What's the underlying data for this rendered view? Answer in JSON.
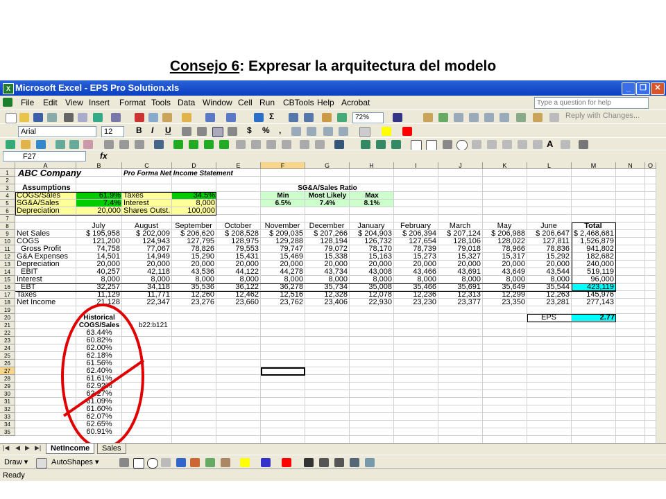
{
  "slide": {
    "title_underlined": "Consejo 6",
    "title_rest": ": Expresar la arquitectura del modelo"
  },
  "window": {
    "title": "Microsoft Excel - EPS Pro Solution.xls",
    "min": "_",
    "max": "❐",
    "close": "✕"
  },
  "menu": [
    "File",
    "Edit",
    "View",
    "Insert",
    "Format",
    "Tools",
    "Data",
    "Window",
    "Cell",
    "Run",
    "CBTools",
    "Help",
    "Acrobat"
  ],
  "help_placeholder": "Type a question for help",
  "toolbar": {
    "font": "Arial",
    "size": "12",
    "zoom": "72%",
    "reply": "Reply with Changes...",
    "bold": "B",
    "italic": "I",
    "underline": "U",
    "currency": "$",
    "percent": "%",
    "comma": ",",
    "sigma": "Σ"
  },
  "formula_bar": {
    "name_box": "F27",
    "fx": "fx"
  },
  "columns": [
    "A",
    "B",
    "C",
    "D",
    "E",
    "F",
    "G",
    "H",
    "I",
    "J",
    "K",
    "L",
    "M",
    "N",
    "O"
  ],
  "rows": [
    "1",
    "2",
    "3",
    "4",
    "5",
    "6",
    "7",
    "8",
    "9",
    "10",
    "11",
    "12",
    "13",
    "14",
    "15",
    "16",
    "17",
    "18",
    "19",
    "20",
    "21",
    "22",
    "23",
    "24",
    "25",
    "26",
    "27",
    "28",
    "29",
    "30",
    "31",
    "32",
    "33",
    "34",
    "35"
  ],
  "sheet": {
    "company": "ABC Company",
    "subtitle": "Pro Forma Net Income Statement",
    "assumptions": "Assumptions",
    "a4": "COGS/Sales",
    "b4": "61.9%",
    "c4": "Taxes",
    "d4": "34.5%",
    "a5": "SG&A/Sales",
    "b5": "7.4%",
    "c5": "Interest",
    "d5": "8,000",
    "a6": "Depreciation",
    "b6": "20,000",
    "c6": "Shares Outst.",
    "d6": "100,000",
    "sga_title": "SG&A/Sales Ratio",
    "sga_headers": [
      "Min",
      "Most Likely",
      "Max"
    ],
    "sga_values": [
      "6.5%",
      "7.4%",
      "8.1%"
    ],
    "months": [
      "July",
      "August",
      "September",
      "October",
      "November",
      "December",
      "January",
      "February",
      "March",
      "May",
      "June",
      "Total"
    ],
    "line_items": [
      {
        "label": "Net Sales",
        "values": [
          "$ 195,958",
          "$ 202,009",
          "$ 206,620",
          "$ 208,528",
          "$ 209,035",
          "$ 207,266",
          "$ 204,903",
          "$ 206,394",
          "$ 207,124",
          "$ 206,988",
          "$ 206,647",
          "$ 2,468,681"
        ]
      },
      {
        "label": "COGS",
        "values": [
          "121,200",
          "124,943",
          "127,795",
          "128,975",
          "129,288",
          "128,194",
          "126,732",
          "127,654",
          "128,106",
          "128,022",
          "127,811",
          "1,526,879"
        ]
      },
      {
        "label": "Gross Profit",
        "values": [
          "74,758",
          "77,067",
          "78,826",
          "79,553",
          "79,747",
          "79,072",
          "78,170",
          "78,739",
          "79,018",
          "78,966",
          "78,836",
          "941,802"
        ]
      },
      {
        "label": "G&A Expenses",
        "values": [
          "14,501",
          "14,949",
          "15,290",
          "15,431",
          "15,469",
          "15,338",
          "15,163",
          "15,273",
          "15,327",
          "15,317",
          "15,292",
          "182,682"
        ]
      },
      {
        "label": "Depreciation",
        "values": [
          "20,000",
          "20,000",
          "20,000",
          "20,000",
          "20,000",
          "20,000",
          "20,000",
          "20,000",
          "20,000",
          "20,000",
          "20,000",
          "240,000"
        ]
      },
      {
        "label": "EBIT",
        "values": [
          "40,257",
          "42,118",
          "43,536",
          "44,122",
          "44,278",
          "43,734",
          "43,008",
          "43,466",
          "43,691",
          "43,649",
          "43,544",
          "519,119"
        ]
      },
      {
        "label": "Interest",
        "values": [
          "8,000",
          "8,000",
          "8,000",
          "8,000",
          "8,000",
          "8,000",
          "8,000",
          "8,000",
          "8,000",
          "8,000",
          "8,000",
          "96,000"
        ]
      },
      {
        "label": "EBT",
        "values": [
          "32,257",
          "34,118",
          "35,536",
          "36,122",
          "36,278",
          "35,734",
          "35,008",
          "35,466",
          "35,691",
          "35,649",
          "35,544",
          "423,119"
        ]
      },
      {
        "label": "Taxes",
        "values": [
          "11,129",
          "11,771",
          "12,260",
          "12,462",
          "12,516",
          "12,328",
          "12,078",
          "12,236",
          "12,313",
          "12,299",
          "12,263",
          "145,976"
        ]
      },
      {
        "label": "Net Income",
        "values": [
          "21,128",
          "22,347",
          "23,276",
          "23,660",
          "23,762",
          "23,406",
          "22,930",
          "23,230",
          "23,377",
          "23,350",
          "23,281",
          "277,143"
        ]
      }
    ],
    "eps_label": "EPS",
    "eps_value": "2.77",
    "hist_title1": "Historical",
    "hist_title2": "COGS/Sales",
    "range_note": "b22:b121",
    "historical": [
      "63.44%",
      "60.82%",
      "62.00%",
      "62.18%",
      "61.56%",
      "62.40%",
      "61.61%",
      "62.92%",
      "62.27%",
      "61.09%",
      "61.60%",
      "62.07%",
      "62.65%",
      "60.91%"
    ]
  },
  "tabs": [
    "NetIncome",
    "Sales"
  ],
  "draw": {
    "draw": "Draw ▾",
    "autoshapes": "AutoShapes ▾"
  },
  "status": "Ready",
  "colors": {
    "green_fill": "#00cc00",
    "yellow_fill": "#ffff99",
    "light_green": "#ccffcc",
    "cyan": "#00ffff",
    "annotation_red": "#e00000"
  }
}
